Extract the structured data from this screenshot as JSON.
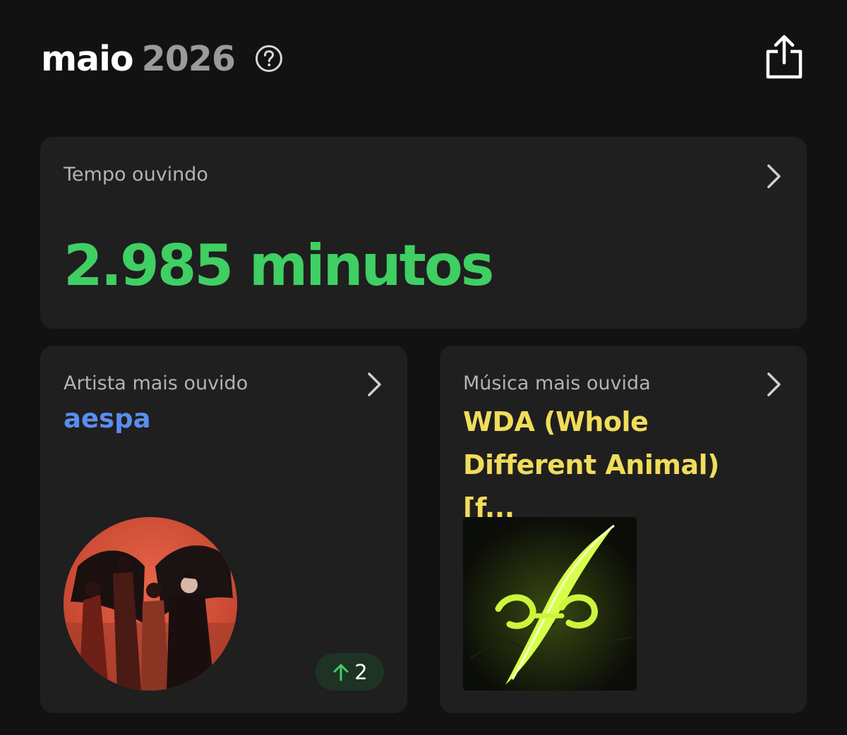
{
  "header": {
    "month": "maio",
    "year": "2026",
    "help_icon": "help-circle-icon",
    "share_icon": "share-icon"
  },
  "listening_time": {
    "label": "Tempo ouvindo",
    "value": "2.985 minutos"
  },
  "top_artist": {
    "label": "Artista mais ouvido",
    "name": "aespa",
    "rank_change": "2",
    "rank_direction": "up"
  },
  "top_song": {
    "label": "Música mais ouvida",
    "title": "WDA (Whole Different Animal) [f..."
  },
  "colors": {
    "background": "#121212",
    "card": "#1f1f1f",
    "minutes_green": "#3fcf63",
    "artist_blue": "#5b8def",
    "song_yellow": "#f1dc5a"
  }
}
